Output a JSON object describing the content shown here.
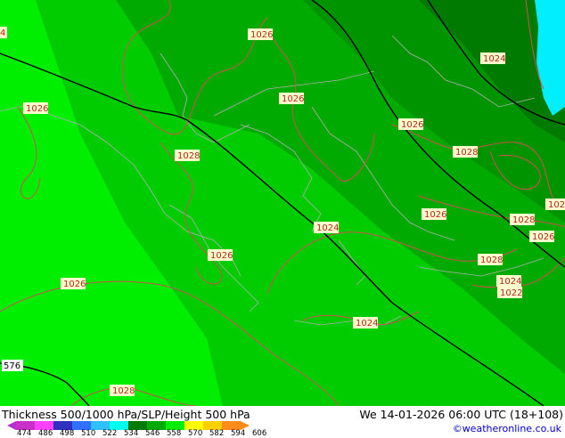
{
  "footer": {
    "title": "Thickness 500/1000 hPa/SLP/Height 500 hPa",
    "datetime": "We 14-01-2026 06:00 UTC (18+108)",
    "credit": "©weatheronline.co.uk"
  },
  "colors": {
    "band_light": "#00ee00",
    "band_mid": "#00cc00",
    "band_dark": "#00aa00",
    "band_darker": "#009400",
    "band_darkest": "#007a00",
    "sea_cyan": "#00eeff",
    "isobar": "#d05050",
    "height_line": "#000000",
    "coastline": "#b0b0b0"
  },
  "scale": {
    "ticks": [
      "474",
      "486",
      "498",
      "510",
      "522",
      "534",
      "546",
      "558",
      "570",
      "582",
      "594",
      "606"
    ],
    "colors": [
      "#c830c8",
      "#ff40ff",
      "#3030c0",
      "#3070ff",
      "#30c0ff",
      "#00ffee",
      "#007a00",
      "#00aa00",
      "#00ee00",
      "#ffff00",
      "#ffd000",
      "#ff8c1a"
    ]
  },
  "isobar_labels": [
    "1026",
    "1026",
    "1028",
    "1026",
    "1024",
    "1026",
    "1028",
    "1026",
    "1028",
    "1024",
    "1026",
    "1028",
    "1026",
    "1026",
    "1024",
    "1022",
    "1024",
    "1028",
    "1026",
    "102",
    "4"
  ],
  "height_labels": [
    "576"
  ]
}
